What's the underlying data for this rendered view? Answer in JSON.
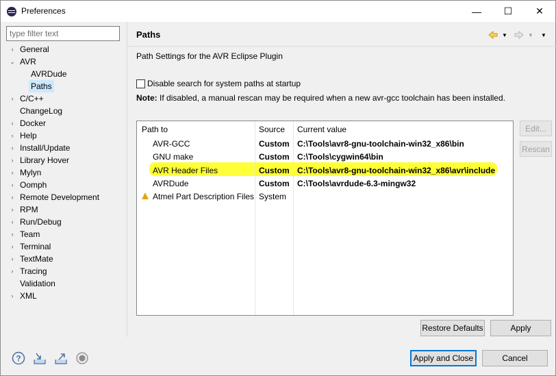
{
  "window": {
    "title": "Preferences",
    "minimize": "—",
    "maximize": "☐",
    "close": "✕"
  },
  "filter": {
    "placeholder": "type filter text"
  },
  "tree": [
    {
      "label": "General",
      "arrow": "›",
      "level": 0
    },
    {
      "label": "AVR",
      "arrow": "⌄",
      "level": 0
    },
    {
      "label": "AVRDude",
      "arrow": "",
      "level": 1
    },
    {
      "label": "Paths",
      "arrow": "",
      "level": 1,
      "selected": true
    },
    {
      "label": "C/C++",
      "arrow": "›",
      "level": 0
    },
    {
      "label": "ChangeLog",
      "arrow": "",
      "level": 0
    },
    {
      "label": "Docker",
      "arrow": "›",
      "level": 0
    },
    {
      "label": "Help",
      "arrow": "›",
      "level": 0
    },
    {
      "label": "Install/Update",
      "arrow": "›",
      "level": 0
    },
    {
      "label": "Library Hover",
      "arrow": "›",
      "level": 0
    },
    {
      "label": "Mylyn",
      "arrow": "›",
      "level": 0
    },
    {
      "label": "Oomph",
      "arrow": "›",
      "level": 0
    },
    {
      "label": "Remote Development",
      "arrow": "›",
      "level": 0
    },
    {
      "label": "RPM",
      "arrow": "›",
      "level": 0
    },
    {
      "label": "Run/Debug",
      "arrow": "›",
      "level": 0
    },
    {
      "label": "Team",
      "arrow": "›",
      "level": 0
    },
    {
      "label": "Terminal",
      "arrow": "›",
      "level": 0
    },
    {
      "label": "TextMate",
      "arrow": "›",
      "level": 0
    },
    {
      "label": "Tracing",
      "arrow": "›",
      "level": 0
    },
    {
      "label": "Validation",
      "arrow": "",
      "level": 0
    },
    {
      "label": "XML",
      "arrow": "›",
      "level": 0
    }
  ],
  "page": {
    "title": "Paths",
    "description": "Path Settings for the AVR Eclipse Plugin",
    "checkbox_label": "Disable search for system paths at startup",
    "note_label": "Note:",
    "note_text": "If disabled, a manual rescan may be required when a new avr-gcc toolchain has been installed."
  },
  "table": {
    "headers": [
      "Path to",
      "Source",
      "Current value"
    ],
    "rows": [
      {
        "path": "AVR-GCC",
        "source": "Custom",
        "value": "C:\\Tools\\avr8-gnu-toolchain-win32_x86\\bin"
      },
      {
        "path": "GNU make",
        "source": "Custom",
        "value": "C:\\Tools\\cygwin64\\bin"
      },
      {
        "path": "AVR Header Files",
        "source": "Custom",
        "value": "C:\\Tools\\avr8-gnu-toolchain-win32_x86\\avr\\include",
        "highlighted": true
      },
      {
        "path": "AVRDude",
        "source": "Custom",
        "value": "C:\\Tools\\avrdude-6.3-mingw32"
      },
      {
        "path": "Atmel Part Description Files",
        "source": "System",
        "value": "",
        "warning": true
      }
    ]
  },
  "buttons": {
    "edit": "Edit...",
    "rescan": "Rescan",
    "restore_defaults": "Restore Defaults",
    "apply": "Apply",
    "apply_and_close": "Apply and Close",
    "cancel": "Cancel"
  },
  "colors": {
    "highlight": "#ffff38",
    "selection": "#cce8ff",
    "default_button_border": "#0078d7"
  }
}
